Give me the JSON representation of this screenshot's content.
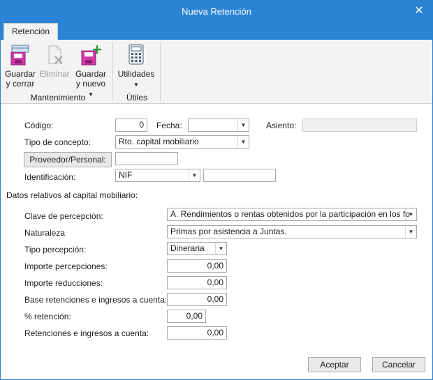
{
  "window": {
    "title": "Nueva Retención"
  },
  "tabs": [
    {
      "label": "Retención"
    }
  ],
  "ribbon": {
    "save_close": "Guardar\ny cerrar",
    "delete": "Eliminar",
    "save_new": "Guardar\ny nuevo",
    "utilities": "Utilidades",
    "group_maintenance": "Mantenimiento",
    "group_utils": "Útiles"
  },
  "form": {
    "codigo_label": "Código:",
    "codigo_value": "0",
    "fecha_label": "Fecha:",
    "fecha_value": "",
    "asiento_label": "Asiento:",
    "asiento_value": "",
    "tipo_concepto_label": "Tipo de concepto:",
    "tipo_concepto_value": "Rto. capital mobiliario",
    "proveedor_button": "Proveedor/Personal:",
    "proveedor_value": "",
    "identificacion_label": "Identificación:",
    "identificacion_type": "NIF",
    "identificacion_value": ""
  },
  "capital": {
    "section_title": "Datos relativos al capital mobiliario:",
    "clave_label": "Clave de percepción:",
    "clave_value": "A. Rendimientos o rentas obtenidos por la participación en los fo",
    "naturaleza_label": "Naturaleza",
    "naturaleza_value": "Primas por asistencia a Juntas.",
    "tipo_percepcion_label": "Tipo percepción:",
    "tipo_percepcion_value": "Dineraria",
    "importe_percepciones_label": "Importe percepciones:",
    "importe_percepciones_value": "0,00",
    "importe_reducciones_label": "Importe reducciones:",
    "importe_reducciones_value": "0,00",
    "base_label": "Base retenciones e ingresos a cuenta:",
    "base_value": "0,00",
    "pct_label": "% retención:",
    "pct_value": "0,00",
    "retenciones_label": "Retenciones e ingresos a cuenta:",
    "retenciones_value": "0,00"
  },
  "footer": {
    "accept": "Aceptar",
    "cancel": "Cancelar"
  }
}
